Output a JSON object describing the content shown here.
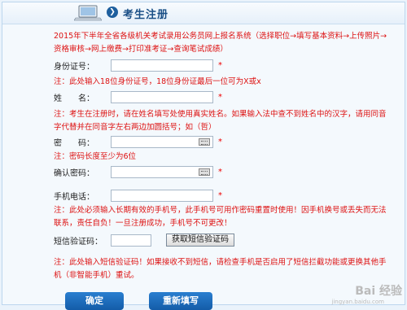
{
  "header": {
    "title": "考生注册"
  },
  "intro": "2015年下半年全省各级机关考试录用公务员网上报名系统（选择职位→填写基本资料→上传照片→资格审核→网上缴费→打印准考证→查询笔试成绩）",
  "fields": {
    "id_card": {
      "label": "身份证号：",
      "value": "",
      "required": "*"
    },
    "id_note": "注：此处输入18位身份证号，18位身份证最后一位可为X或x",
    "name": {
      "label": "姓　　名：",
      "value": "",
      "required": "*"
    },
    "name_note": "注：考生在注册时，请在姓名填写处使用真实姓名。如果输入法中查不到姓名中的汉字，请用同音字代替并在同音字左右两边加圆括号；如（哲）",
    "password": {
      "label": "密　　码：",
      "value": "",
      "required": "*"
    },
    "password_note": "注：密码长度至少为6位",
    "confirm_password": {
      "label": "确认密码：",
      "value": "",
      "required": "*"
    },
    "phone": {
      "label": "手机电话：",
      "value": "",
      "required": "*"
    },
    "phone_note": "注：此处必须输入长期有效的手机号，此手机号可用作密码重置时使用！因手机换号或丢失而无法联系，责任自负！一旦注册成功，手机号不可更改！",
    "sms_code": {
      "label": "短信验证码：",
      "value": "",
      "button": "获取短信验证码"
    },
    "sms_note": "注：此处输入短信验证码！如果接收不到短信，请检查手机是否启用了短信拦截功能或更换其他手机（非智能手机）重试。"
  },
  "actions": {
    "confirm": "确定",
    "reset": "重新填写"
  },
  "watermark": {
    "main": "Bai 经验",
    "sub": "jingyan.baidu.com"
  }
}
